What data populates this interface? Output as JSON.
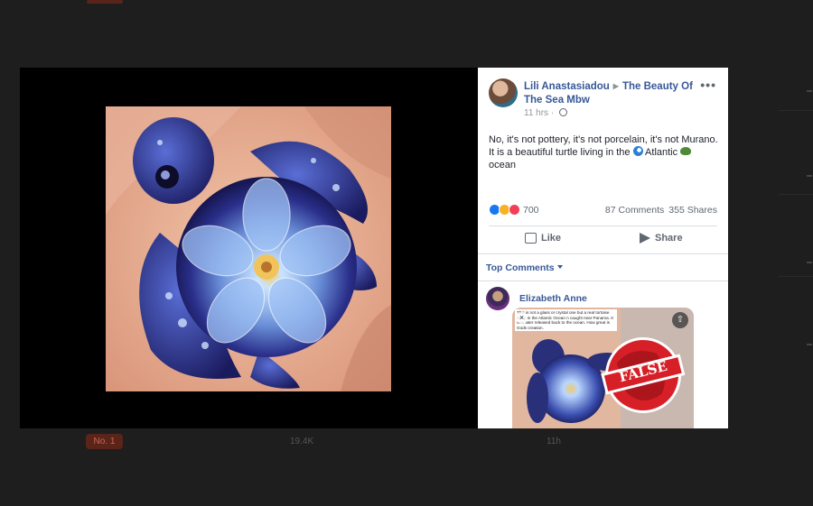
{
  "background": {
    "badge_label": "No. 1",
    "stat_a": "19.4K",
    "stat_b": "11h"
  },
  "post": {
    "author": "Lili Anastasiadou",
    "page": "The Beauty Of The Sea Mbw",
    "time": "11 hrs",
    "text_line1": "No, it's not pottery, it's not porcelain, it's not Murano.",
    "text_line2a": "It is a beautiful turtle living in the",
    "text_line2b": "Atlantic",
    "text_line3": "ocean",
    "reaction_count": "700",
    "comments": "87 Comments",
    "shares": "355 Shares",
    "like_label": "Like",
    "share_label": "Share"
  },
  "comments": {
    "sort_label": "Top Comments",
    "first": {
      "name": "Elizabeth Anne",
      "image_caption": "This is not a glass or crystal one but a real tortoise living in the Atlantic Ocean n caught near Panama. It was later released back to the ocean. How great is Gods creation.",
      "stamp": "FALSE"
    }
  },
  "icons": [
    "more-icon",
    "globe-icon",
    "like-icon",
    "share-icon",
    "caret-down-icon",
    "wave-emoji-icon",
    "turtle-emoji-icon"
  ],
  "colors": {
    "link": "#385898",
    "like": "#1877f2",
    "love": "#f33e58",
    "wow": "#f7b125",
    "false_stamp": "#d61f26"
  }
}
